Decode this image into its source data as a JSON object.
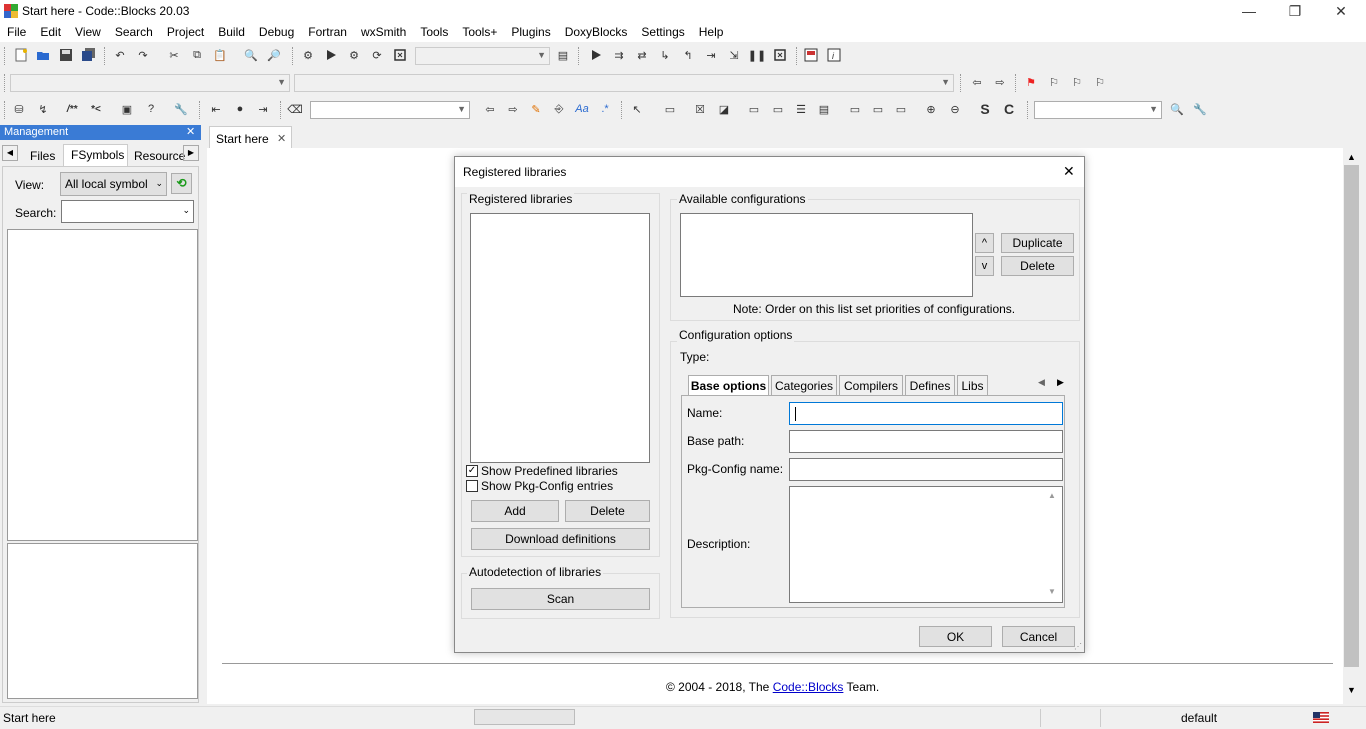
{
  "window": {
    "title": "Start here - Code::Blocks 20.03",
    "minimize": "—",
    "restore": "❐",
    "close": "✕"
  },
  "menu": [
    "File",
    "Edit",
    "View",
    "Search",
    "Project",
    "Build",
    "Debug",
    "Fortran",
    "wxSmith",
    "Tools",
    "Tools+",
    "Plugins",
    "DoxyBlocks",
    "Settings",
    "Help"
  ],
  "management": {
    "title": "Management",
    "close": "✕",
    "tabs": [
      "Files",
      "FSymbols",
      "Resource"
    ],
    "view_label": "View:",
    "view_value": "All local symbol",
    "search_label": "Search:",
    "search_value": ""
  },
  "editor": {
    "tab_label": "Start here",
    "tab_close": "✕",
    "footer_prefix": "© 2004 - 2018, The ",
    "footer_link": "Code::Blocks",
    "footer_suffix": " Team."
  },
  "statusbar": {
    "left": "Start here",
    "right": "default"
  },
  "dialog": {
    "title": "Registered libraries",
    "close": "✕",
    "registered_group": "Registered libraries",
    "show_predefined": "Show Predefined libraries",
    "show_predefined_checked": true,
    "show_pkgconfig": "Show Pkg-Config entries",
    "show_pkgconfig_checked": false,
    "add": "Add",
    "delete": "Delete",
    "download": "Download definitions",
    "autodetect_group": "Autodetection of libraries",
    "scan": "Scan",
    "available_group": "Available configurations",
    "up": "^",
    "down": "v",
    "duplicate": "Duplicate",
    "delete_config": "Delete",
    "note": "Note: Order on this list set priorities of configurations.",
    "config_group": "Configuration options",
    "type_label": "Type:",
    "tabs": [
      "Base options",
      "Categories",
      "Compilers",
      "Defines",
      "Libs"
    ],
    "name_label": "Name:",
    "basepath_label": "Base path:",
    "pkgconfig_label": "Pkg-Config name:",
    "description_label": "Description:",
    "name_value": "",
    "basepath_value": "",
    "pkgconfig_value": "",
    "ok": "OK",
    "cancel": "Cancel"
  }
}
